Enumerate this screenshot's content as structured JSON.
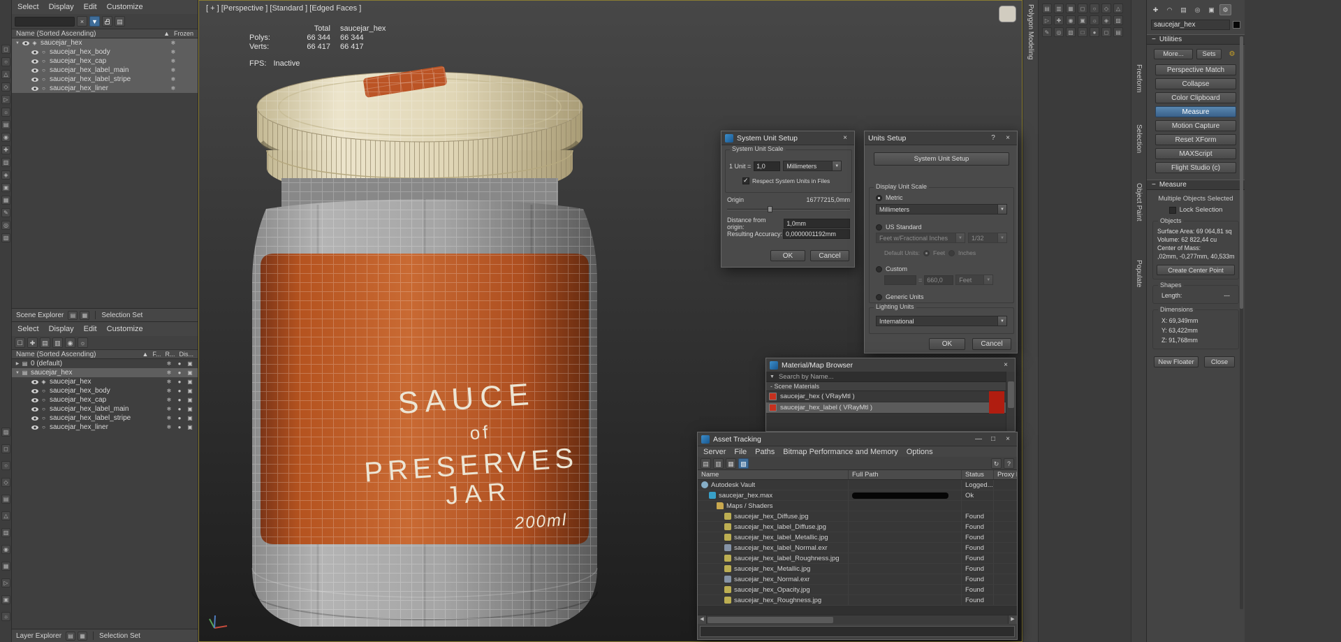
{
  "left_dock": {
    "icons_top": [
      "◻",
      "○",
      "△",
      "◇",
      "▷",
      "☼",
      "▤",
      "◉",
      "✚",
      "▥",
      "◈",
      "▣",
      "▦",
      "✎",
      "◎",
      "▧"
    ],
    "icons_bottom": [
      "▨",
      "◻",
      "○",
      "◇",
      "▤",
      "△",
      "▥",
      "◉",
      "▦",
      "▷",
      "▣",
      "☼"
    ]
  },
  "scene_explorer": {
    "menus": [
      "Select",
      "Display",
      "Edit",
      "Customize"
    ],
    "toolbar": {
      "clear_icon": "×",
      "funnel_icon": "▼",
      "grid_icon": "▤"
    },
    "header_name": "Name (Sorted Ascending)",
    "sort_arrow": "▲",
    "header_frozen": "Frozen",
    "frozen_glyph": "❄",
    "rows": [
      {
        "label": "saucejar_hex",
        "level": 0,
        "selected": true,
        "arrow": "▼",
        "glyph": "◈"
      },
      {
        "label": "saucejar_hex_body",
        "level": 1,
        "selected": true,
        "glyph": "○"
      },
      {
        "label": "saucejar_hex_cap",
        "level": 1,
        "selected": true,
        "glyph": "○"
      },
      {
        "label": "saucejar_hex_label_main",
        "level": 1,
        "selected": true,
        "glyph": "○"
      },
      {
        "label": "saucejar_hex_label_stripe",
        "level": 1,
        "selected": true,
        "glyph": "○"
      },
      {
        "label": "saucejar_hex_liner",
        "level": 1,
        "selected": true,
        "glyph": "○"
      }
    ],
    "footer_label": "Scene Explorer",
    "footer_icons": [
      "▤",
      "▦"
    ],
    "selection_set_label": "Selection Set"
  },
  "layer_explorer": {
    "menus": [
      "Select",
      "Display",
      "Edit",
      "Customize"
    ],
    "toolbar_icons": [
      "☐",
      "✚",
      "▤",
      "▥",
      "◉",
      "☼"
    ],
    "header_name": "Name (Sorted Ascending)",
    "sort_arrow": "▲",
    "header_cols": [
      "F...",
      "R...",
      "Dis..."
    ],
    "row_icons": [
      "❄",
      "●",
      "▣"
    ],
    "rows": [
      {
        "label": "0 (default)",
        "level": 0,
        "arrow": "▶",
        "glyph": "▤",
        "eye": false
      },
      {
        "label": "saucejar_hex",
        "level": 0,
        "selected": true,
        "arrow": "▼",
        "glyph": "▤",
        "eye": false
      },
      {
        "label": "saucejar_hex",
        "level": 1,
        "glyph": "◈",
        "eye": true
      },
      {
        "label": "saucejar_hex_body",
        "level": 1,
        "glyph": "○",
        "eye": true
      },
      {
        "label": "saucejar_hex_cap",
        "level": 1,
        "glyph": "○",
        "eye": true
      },
      {
        "label": "saucejar_hex_label_main",
        "level": 1,
        "glyph": "○",
        "eye": true
      },
      {
        "label": "saucejar_hex_label_stripe",
        "level": 1,
        "glyph": "○",
        "eye": true
      },
      {
        "label": "saucejar_hex_liner",
        "level": 1,
        "glyph": "○",
        "eye": true
      }
    ],
    "footer_label": "Layer Explorer",
    "footer_icons": [
      "▤",
      "▦"
    ],
    "selection_set_label": "Selection Set"
  },
  "viewport": {
    "label": "[ + ] [Perspective ] [Standard ] [Edged Faces ]",
    "stats": {
      "col_total": "Total",
      "col_object": "saucejar_hex",
      "polys_label": "Polys:",
      "polys_total": "66 344",
      "polys_object": "66 344",
      "verts_label": "Verts:",
      "verts_total": "66 417",
      "verts_object": "66 417",
      "fps_label": "FPS:",
      "fps_value": "Inactive"
    },
    "jar_label": {
      "line1": "SAUCE",
      "line2": "of",
      "line3": "PRESERVES",
      "line4": "JAR",
      "volume": "200ml"
    }
  },
  "ribbon": {
    "main_tab": "Polygon Modeling",
    "side_tabs": [
      "Freeform",
      "Selection",
      "Object Paint",
      "Populate"
    ],
    "icons": [
      "▤",
      "▥",
      "▦",
      "◻",
      "○",
      "◇",
      "△",
      "▷",
      "✚",
      "◉",
      "▣",
      "☼",
      "◈",
      "▨",
      "✎",
      "◎",
      "▧",
      "□",
      "●",
      "◻",
      "▤"
    ]
  },
  "command_panel": {
    "tabs": [
      {
        "glyph": "✚",
        "name": "create"
      },
      {
        "glyph": "◠",
        "name": "modify"
      },
      {
        "glyph": "▤",
        "name": "hierarchy"
      },
      {
        "glyph": "◎",
        "name": "motion"
      },
      {
        "glyph": "▣",
        "name": "display"
      },
      {
        "glyph": "⚙",
        "name": "utilities",
        "active": true
      }
    ],
    "object_name": "saucejar_hex",
    "rollout_collapse_icon": "−",
    "utilities_title": "Utilities",
    "more_button": "More...",
    "sets_button": "Sets",
    "config_icon": "⚙",
    "utility_buttons": [
      {
        "label": "Perspective Match"
      },
      {
        "label": "Collapse"
      },
      {
        "label": "Color Clipboard"
      },
      {
        "label": "Measure",
        "active": true
      },
      {
        "label": "Motion Capture"
      },
      {
        "label": "Reset XForm"
      },
      {
        "label": "MAXScript"
      },
      {
        "label": "Flight Studio (c)"
      }
    ],
    "measure_title": "Measure",
    "selection_info": "Multiple Objects Selected",
    "lock_label": "Lock Selection",
    "objects_group": "Objects",
    "surface_area": "Surface Area: 69 064,81 sq",
    "volume": "Volume: 62 822,44 cu",
    "center_of_mass_label": "Center of Mass:",
    "center_of_mass_value": ",02mm, -0,277mm, 40,533m",
    "create_center_point": "Create Center Point",
    "shapes_group": "Shapes",
    "length_label": "Length:",
    "length_value": "---",
    "dimensions_group": "Dimensions",
    "dim_x": "X: 69,349mm",
    "dim_y": "Y: 63,422mm",
    "dim_z": "Z: 91,768mm",
    "new_floater": "New Floater",
    "close": "Close"
  },
  "dialog_system_unit": {
    "title": "System Unit Setup",
    "close_icon": "×",
    "group": "System Unit Scale",
    "unit_label": "1 Unit =",
    "unit_value": "1,0",
    "unit_option": "Millimeters",
    "respect_label": "Respect System Units in Files",
    "origin_label": "Origin",
    "origin_value": "16777215,0mm",
    "distance_label": "Distance from origin:",
    "distance_value": "1,0mm",
    "accuracy_label": "Resulting Accuracy:",
    "accuracy_value": "0,0000001192mm",
    "ok": "OK",
    "cancel": "Cancel"
  },
  "dialog_units": {
    "title": "Units Setup",
    "help_icon": "?",
    "close_icon": "×",
    "system_unit_button": "System Unit Setup",
    "display_group": "Display Unit Scale",
    "metric_label": "Metric",
    "metric_option": "Millimeters",
    "us_label": "US Standard",
    "us_option": "Feet w/Fractional Inches",
    "us_fraction": "1/32",
    "default_units_label": "Default Units:",
    "feet_label": "Feet",
    "inches_label": "Inches",
    "custom_label": "Custom",
    "custom_equals": "=",
    "custom_value": "660,0",
    "custom_option": "Feet",
    "generic_label": "Generic Units",
    "lighting_group": "Lighting Units",
    "lighting_option": "International",
    "ok": "OK",
    "cancel": "Cancel"
  },
  "material_browser": {
    "title": "Material/Map Browser",
    "close_icon": "×",
    "search_arrow": "▼",
    "search_placeholder": "Search by Name...",
    "section_label": "- Scene Materials",
    "materials": [
      {
        "name": "saucejar_hex ( VRayMtl )"
      },
      {
        "name": "saucejar_hex_label ( VRayMtl )",
        "selected": true
      }
    ]
  },
  "asset_tracking": {
    "title": "Asset Tracking",
    "window_icons": {
      "minimize": "—",
      "maximize": "□",
      "close": "×"
    },
    "menus": [
      "Server",
      "File",
      "Paths",
      "Bitmap Performance and Memory",
      "Options"
    ],
    "toolbar_icons": [
      {
        "glyph": "▤"
      },
      {
        "glyph": "▥"
      },
      {
        "glyph": "▦"
      },
      {
        "glyph": "▧",
        "active": true
      }
    ],
    "toolbar_right_icons": [
      {
        "glyph": "↻"
      },
      {
        "glyph": "?"
      }
    ],
    "columns": [
      "Name",
      "Full Path",
      "Status",
      "Proxy R..."
    ],
    "rows": [
      {
        "name": "Autodesk Vault",
        "status": "Logged...",
        "level": 0,
        "icon": "vault"
      },
      {
        "name": "saucejar_hex.max",
        "status": "Ok",
        "level": 1,
        "icon": "max",
        "redacted": true
      },
      {
        "name": "Maps / Shaders",
        "status": "",
        "level": 2,
        "icon": "folder"
      },
      {
        "name": "saucejar_hex_Diffuse.jpg",
        "status": "Found",
        "level": 3,
        "icon": "jpg"
      },
      {
        "name": "saucejar_hex_label_Diffuse.jpg",
        "status": "Found",
        "level": 3,
        "icon": "jpg"
      },
      {
        "name": "saucejar_hex_label_Metallic.jpg",
        "status": "Found",
        "level": 3,
        "icon": "jpg"
      },
      {
        "name": "saucejar_hex_label_Normal.exr",
        "status": "Found",
        "level": 3,
        "icon": "exr"
      },
      {
        "name": "saucejar_hex_label_Roughness.jpg",
        "status": "Found",
        "level": 3,
        "icon": "jpg"
      },
      {
        "name": "saucejar_hex_Metallic.jpg",
        "status": "Found",
        "level": 3,
        "icon": "jpg"
      },
      {
        "name": "saucejar_hex_Normal.exr",
        "status": "Found",
        "level": 3,
        "icon": "exr"
      },
      {
        "name": "saucejar_hex_Opacity.jpg",
        "status": "Found",
        "level": 3,
        "icon": "jpg"
      },
      {
        "name": "saucejar_hex_Roughness.jpg",
        "status": "Found",
        "level": 3,
        "icon": "jpg"
      }
    ]
  }
}
